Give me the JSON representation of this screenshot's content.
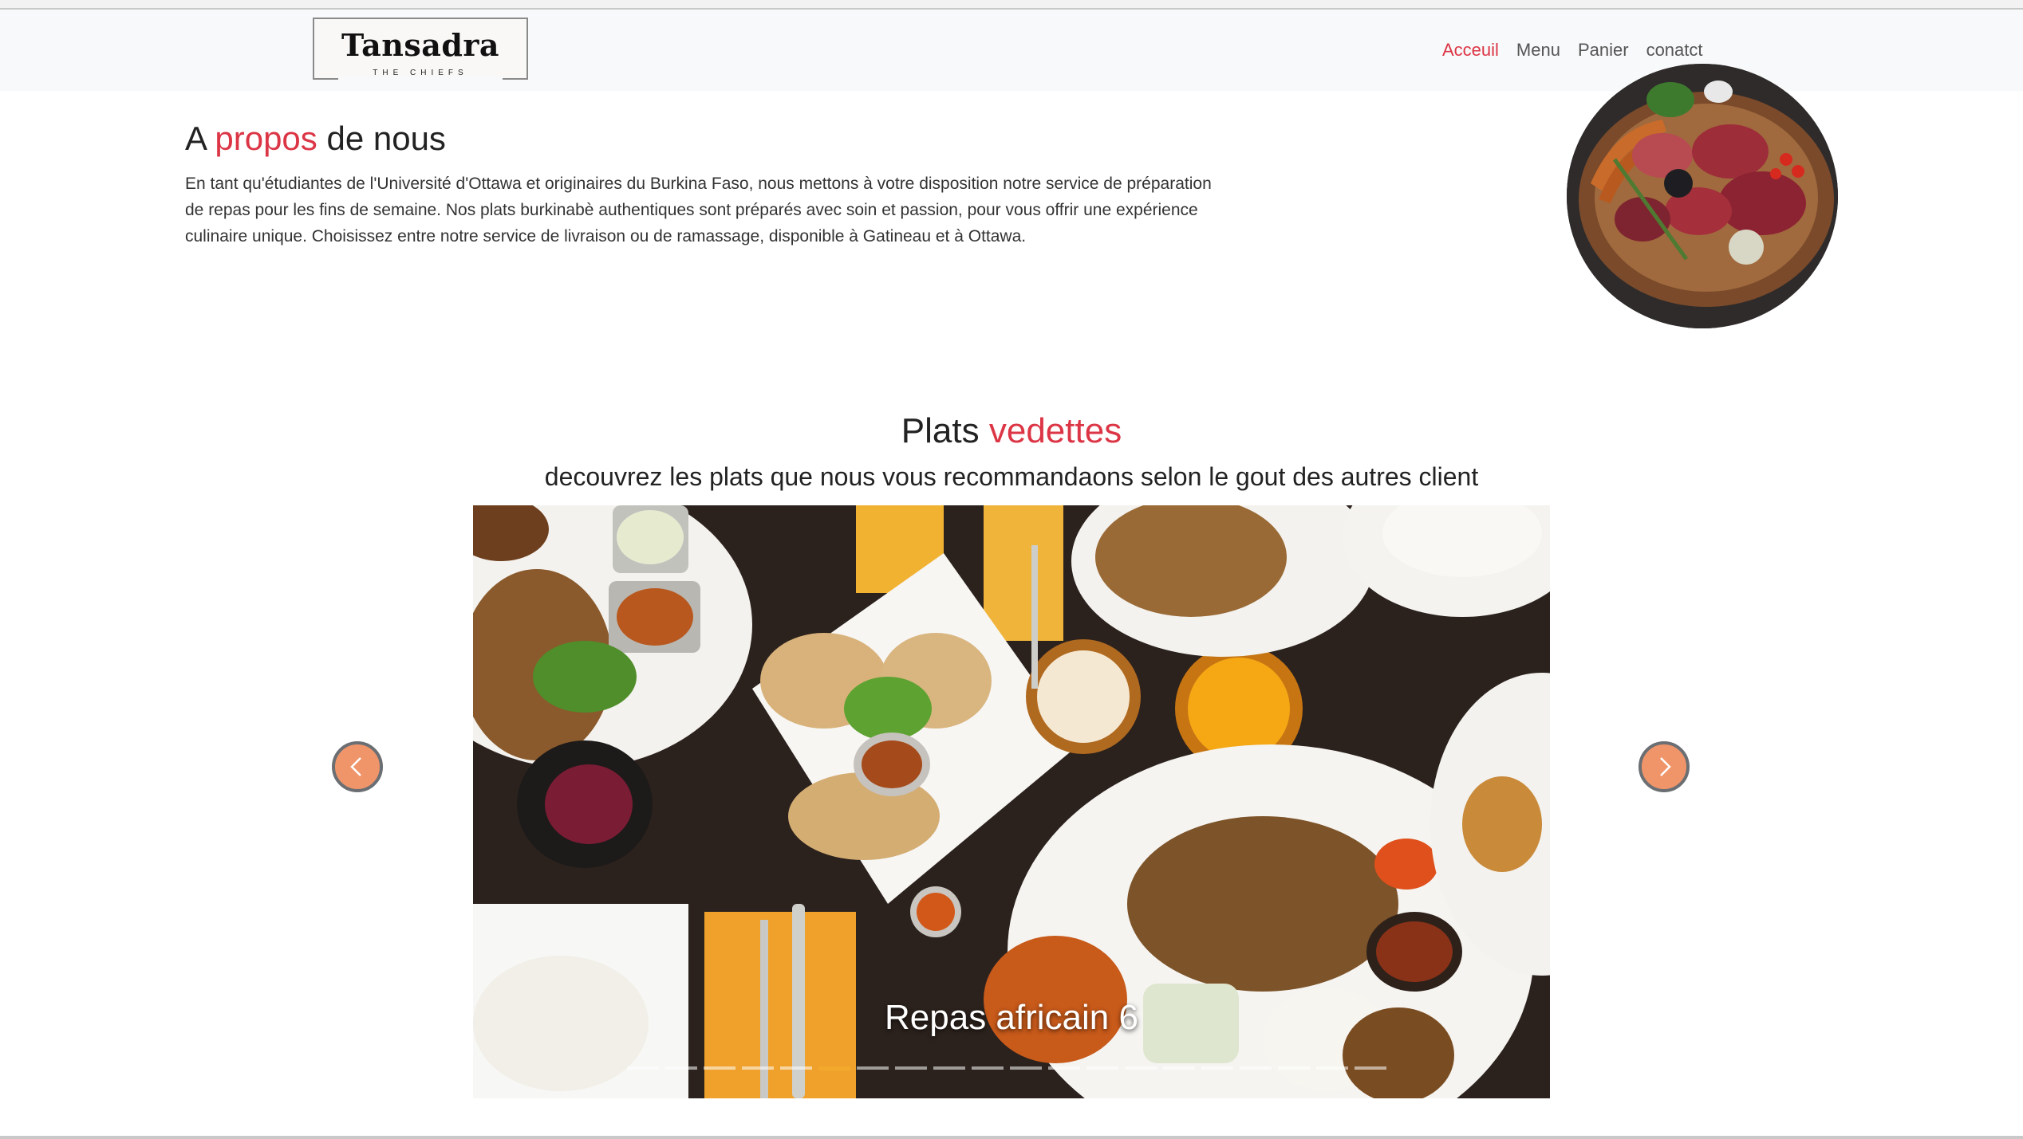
{
  "header": {
    "brand_name": "Tansadra",
    "brand_tagline": "THE CHIEFS",
    "nav": [
      {
        "label": "Acceuil",
        "active": true
      },
      {
        "label": "Menu",
        "active": false
      },
      {
        "label": "Panier",
        "active": false
      },
      {
        "label": "conatct",
        "active": false
      }
    ]
  },
  "about": {
    "title_prefix": "A",
    "title_accent": "propos",
    "title_suffix": "de nous",
    "text": "En tant qu'étudiantes de l'Université d'Ottawa et originaires du Burkina Faso, nous mettons à votre disposition notre service de préparation de repas pour les fins de semaine. Nos plats burkinabè authentiques sont préparés avec soin et passion, pour vous offrir une expérience culinaire unique. Choisissez entre notre service de livraison ou de ramassage, disponible à Gatineau et à Ottawa."
  },
  "featured": {
    "title_prefix": "Plats",
    "title_accent": "vedettes",
    "subtitle": "decouvrez les plats que nous vous recommandaons selon le gout des autres client",
    "carousel": {
      "caption": "Repas africain 6",
      "slide_count": 20,
      "active_index": 5
    }
  },
  "colors": {
    "accent": "#dc3545",
    "navbar_bg": "#f8f9fa",
    "arrow_bg": "#f0956a",
    "indicator_active": "#f3a92b"
  },
  "icons": {
    "prev": "chevron-left-icon",
    "next": "chevron-right-icon"
  }
}
